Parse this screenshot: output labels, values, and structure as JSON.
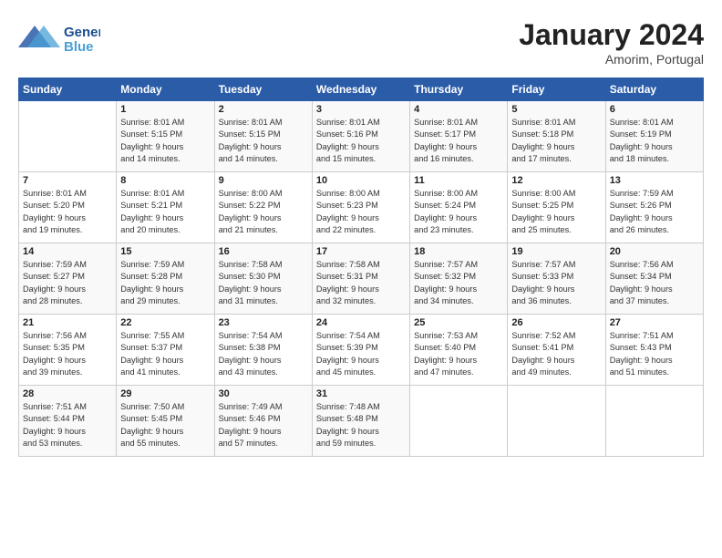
{
  "logo": {
    "line1": "General",
    "line2": "Blue"
  },
  "header": {
    "month": "January 2024",
    "location": "Amorim, Portugal"
  },
  "days_of_week": [
    "Sunday",
    "Monday",
    "Tuesday",
    "Wednesday",
    "Thursday",
    "Friday",
    "Saturday"
  ],
  "weeks": [
    [
      {
        "day": "",
        "info": ""
      },
      {
        "day": "1",
        "info": "Sunrise: 8:01 AM\nSunset: 5:15 PM\nDaylight: 9 hours\nand 14 minutes."
      },
      {
        "day": "2",
        "info": "Sunrise: 8:01 AM\nSunset: 5:15 PM\nDaylight: 9 hours\nand 14 minutes."
      },
      {
        "day": "3",
        "info": "Sunrise: 8:01 AM\nSunset: 5:16 PM\nDaylight: 9 hours\nand 15 minutes."
      },
      {
        "day": "4",
        "info": "Sunrise: 8:01 AM\nSunset: 5:17 PM\nDaylight: 9 hours\nand 16 minutes."
      },
      {
        "day": "5",
        "info": "Sunrise: 8:01 AM\nSunset: 5:18 PM\nDaylight: 9 hours\nand 17 minutes."
      },
      {
        "day": "6",
        "info": "Sunrise: 8:01 AM\nSunset: 5:19 PM\nDaylight: 9 hours\nand 18 minutes."
      }
    ],
    [
      {
        "day": "7",
        "info": "Sunrise: 8:01 AM\nSunset: 5:20 PM\nDaylight: 9 hours\nand 19 minutes."
      },
      {
        "day": "8",
        "info": "Sunrise: 8:01 AM\nSunset: 5:21 PM\nDaylight: 9 hours\nand 20 minutes."
      },
      {
        "day": "9",
        "info": "Sunrise: 8:00 AM\nSunset: 5:22 PM\nDaylight: 9 hours\nand 21 minutes."
      },
      {
        "day": "10",
        "info": "Sunrise: 8:00 AM\nSunset: 5:23 PM\nDaylight: 9 hours\nand 22 minutes."
      },
      {
        "day": "11",
        "info": "Sunrise: 8:00 AM\nSunset: 5:24 PM\nDaylight: 9 hours\nand 23 minutes."
      },
      {
        "day": "12",
        "info": "Sunrise: 8:00 AM\nSunset: 5:25 PM\nDaylight: 9 hours\nand 25 minutes."
      },
      {
        "day": "13",
        "info": "Sunrise: 7:59 AM\nSunset: 5:26 PM\nDaylight: 9 hours\nand 26 minutes."
      }
    ],
    [
      {
        "day": "14",
        "info": "Sunrise: 7:59 AM\nSunset: 5:27 PM\nDaylight: 9 hours\nand 28 minutes."
      },
      {
        "day": "15",
        "info": "Sunrise: 7:59 AM\nSunset: 5:28 PM\nDaylight: 9 hours\nand 29 minutes."
      },
      {
        "day": "16",
        "info": "Sunrise: 7:58 AM\nSunset: 5:30 PM\nDaylight: 9 hours\nand 31 minutes."
      },
      {
        "day": "17",
        "info": "Sunrise: 7:58 AM\nSunset: 5:31 PM\nDaylight: 9 hours\nand 32 minutes."
      },
      {
        "day": "18",
        "info": "Sunrise: 7:57 AM\nSunset: 5:32 PM\nDaylight: 9 hours\nand 34 minutes."
      },
      {
        "day": "19",
        "info": "Sunrise: 7:57 AM\nSunset: 5:33 PM\nDaylight: 9 hours\nand 36 minutes."
      },
      {
        "day": "20",
        "info": "Sunrise: 7:56 AM\nSunset: 5:34 PM\nDaylight: 9 hours\nand 37 minutes."
      }
    ],
    [
      {
        "day": "21",
        "info": "Sunrise: 7:56 AM\nSunset: 5:35 PM\nDaylight: 9 hours\nand 39 minutes."
      },
      {
        "day": "22",
        "info": "Sunrise: 7:55 AM\nSunset: 5:37 PM\nDaylight: 9 hours\nand 41 minutes."
      },
      {
        "day": "23",
        "info": "Sunrise: 7:54 AM\nSunset: 5:38 PM\nDaylight: 9 hours\nand 43 minutes."
      },
      {
        "day": "24",
        "info": "Sunrise: 7:54 AM\nSunset: 5:39 PM\nDaylight: 9 hours\nand 45 minutes."
      },
      {
        "day": "25",
        "info": "Sunrise: 7:53 AM\nSunset: 5:40 PM\nDaylight: 9 hours\nand 47 minutes."
      },
      {
        "day": "26",
        "info": "Sunrise: 7:52 AM\nSunset: 5:41 PM\nDaylight: 9 hours\nand 49 minutes."
      },
      {
        "day": "27",
        "info": "Sunrise: 7:51 AM\nSunset: 5:43 PM\nDaylight: 9 hours\nand 51 minutes."
      }
    ],
    [
      {
        "day": "28",
        "info": "Sunrise: 7:51 AM\nSunset: 5:44 PM\nDaylight: 9 hours\nand 53 minutes."
      },
      {
        "day": "29",
        "info": "Sunrise: 7:50 AM\nSunset: 5:45 PM\nDaylight: 9 hours\nand 55 minutes."
      },
      {
        "day": "30",
        "info": "Sunrise: 7:49 AM\nSunset: 5:46 PM\nDaylight: 9 hours\nand 57 minutes."
      },
      {
        "day": "31",
        "info": "Sunrise: 7:48 AM\nSunset: 5:48 PM\nDaylight: 9 hours\nand 59 minutes."
      },
      {
        "day": "",
        "info": ""
      },
      {
        "day": "",
        "info": ""
      },
      {
        "day": "",
        "info": ""
      }
    ]
  ]
}
